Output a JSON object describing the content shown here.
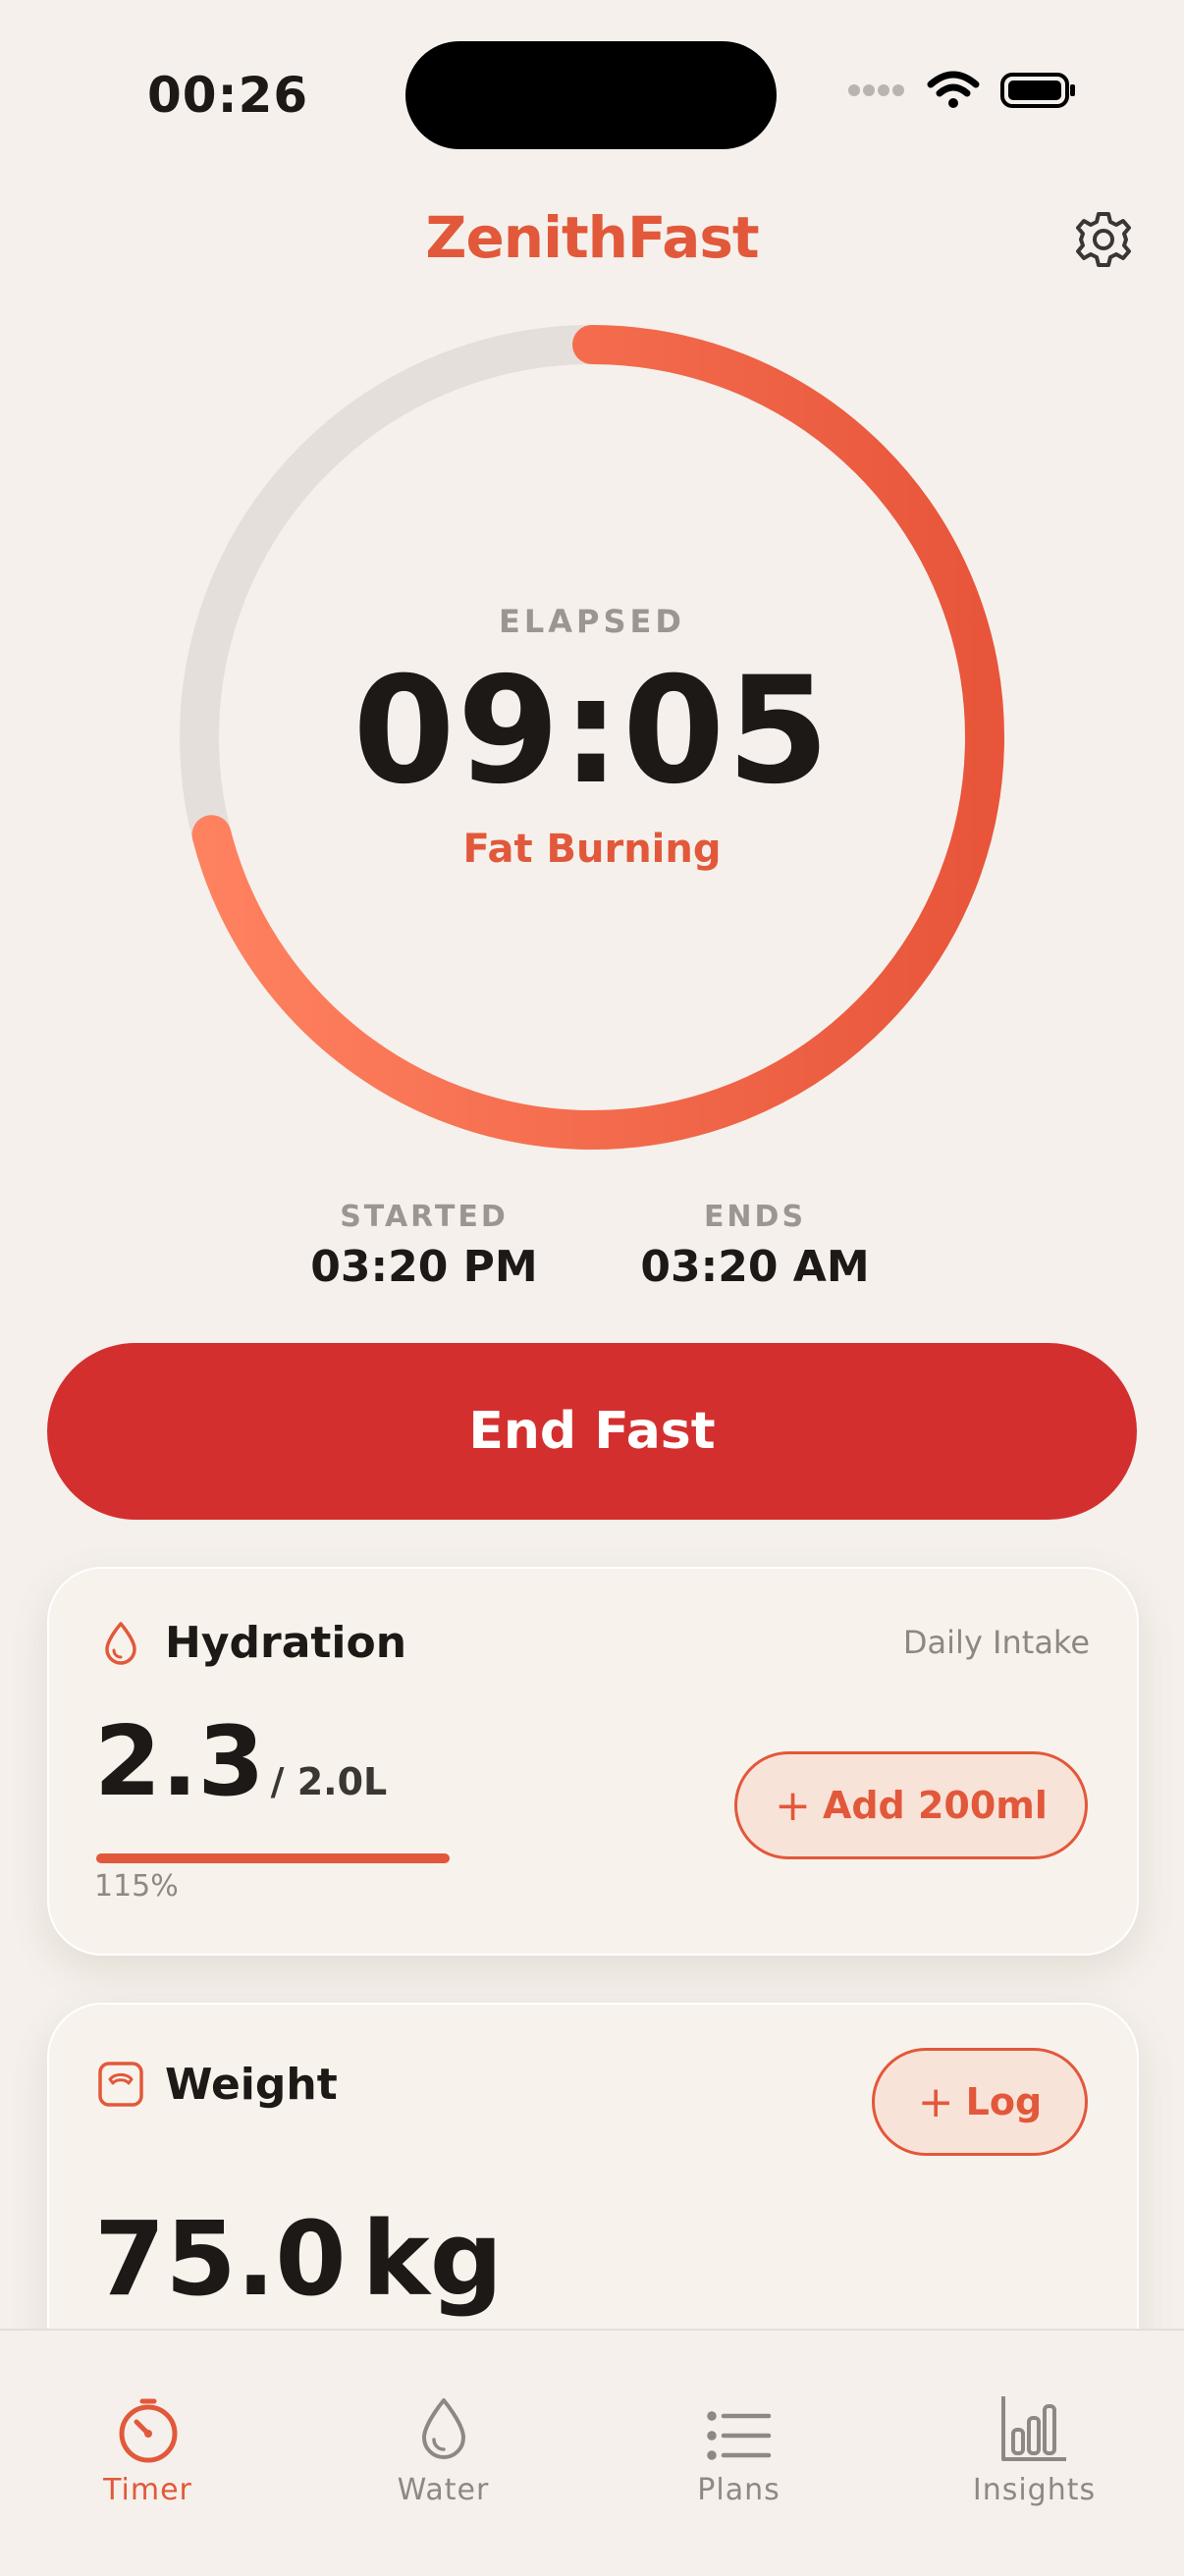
{
  "status_bar": {
    "time": "00:26"
  },
  "header": {
    "app_title": "ZenithFast"
  },
  "timer": {
    "elapsed_label": "ELAPSED",
    "elapsed_time": "09:05",
    "phase": "Fat Burning",
    "progress_fraction": 0.71,
    "started_label": "STARTED",
    "started_value": "03:20 PM",
    "ends_label": "ENDS",
    "ends_value": "03:20 AM"
  },
  "actions": {
    "end_fast": "End Fast"
  },
  "hydration": {
    "title": "Hydration",
    "subtitle": "Daily Intake",
    "amount": "2.3",
    "goal": "/ 2.0L",
    "percent": "115%",
    "progress_fraction": 1.0,
    "add_button": "Add 200ml"
  },
  "weight": {
    "title": "Weight",
    "log_button": "Log",
    "value": "75.0",
    "unit": "kg"
  },
  "tabs": [
    {
      "label": "Timer",
      "icon": "timer-icon",
      "active": true
    },
    {
      "label": "Water",
      "icon": "water-drop-icon",
      "active": false
    },
    {
      "label": "Plans",
      "icon": "list-icon",
      "active": false
    },
    {
      "label": "Insights",
      "icon": "bar-chart-icon",
      "active": false
    }
  ],
  "colors": {
    "accent": "#E2583A",
    "danger": "#D42F2F",
    "background": "#F5F0EB"
  }
}
